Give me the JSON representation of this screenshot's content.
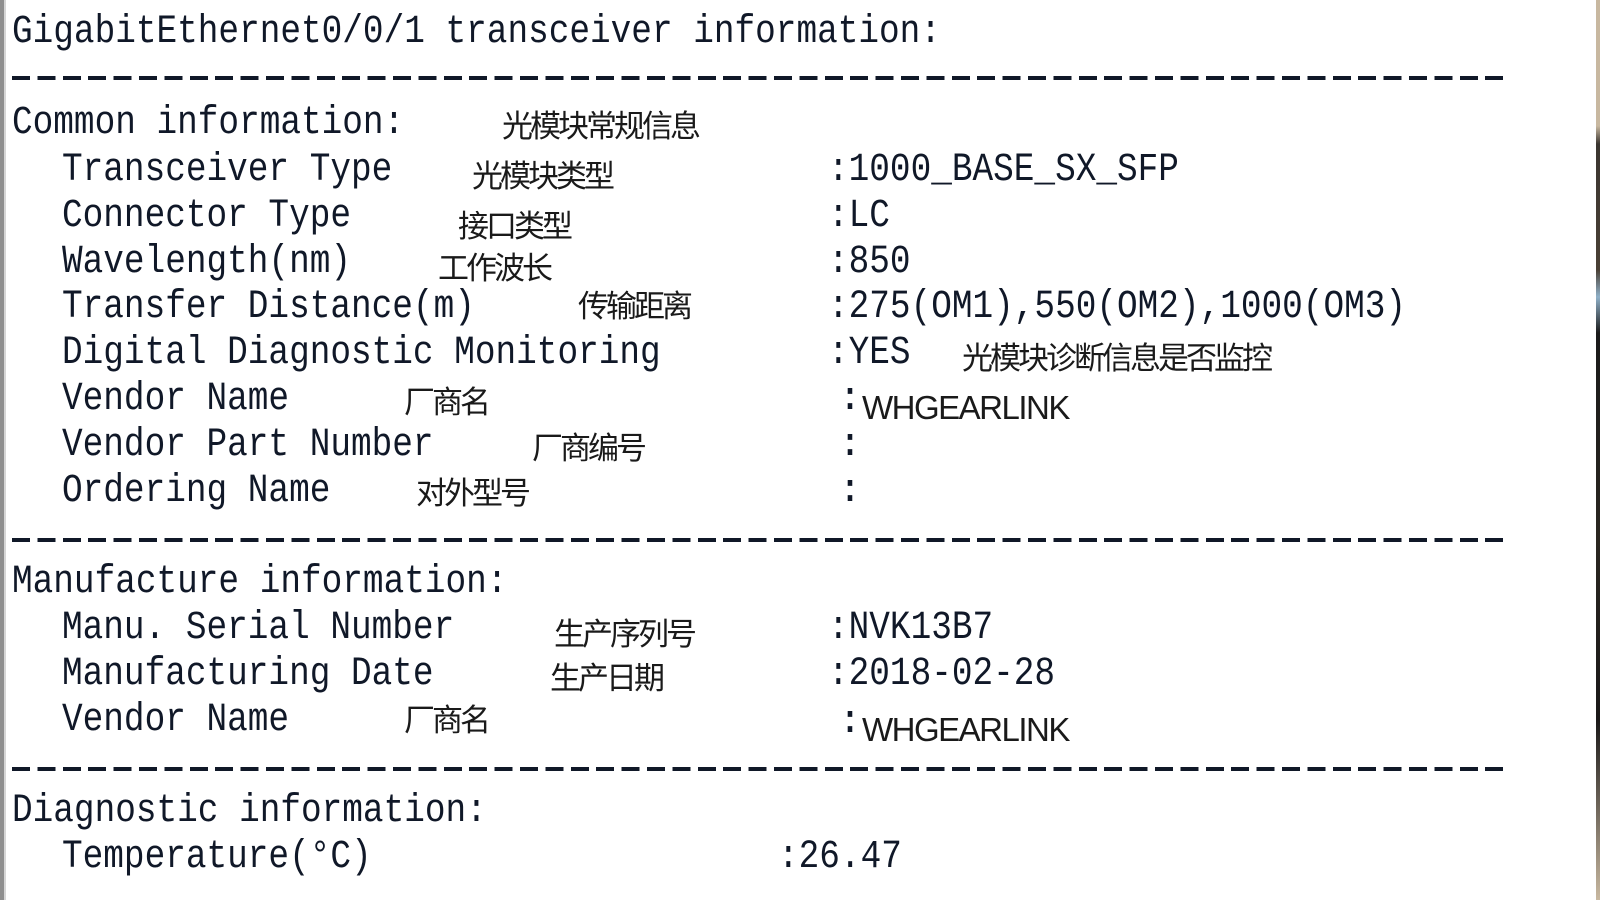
{
  "title": "GigabitEthernet0/0/1 transceiver information:",
  "sections": {
    "common": {
      "heading": "Common information:",
      "heading_cn": "光模块常规信息",
      "rows": [
        {
          "label": "Transceiver Type",
          "cn": "光模块类型",
          "value": ":1000_BASE_SX_SFP"
        },
        {
          "label": "Connector Type",
          "cn": "接口类型",
          "value": ":LC"
        },
        {
          "label": "Wavelength(nm)",
          "cn": "工作波长",
          "value": ":850"
        },
        {
          "label": "Transfer Distance(m)",
          "cn": "传输距离",
          "value": ":275(OM1),550(OM2),1000(OM3)"
        },
        {
          "label": "Digital Diagnostic Monitoring",
          "cn": "",
          "value": ":YES",
          "value_cn": "光模块诊断信息是否监控"
        },
        {
          "label": "Vendor Name",
          "cn": "厂商名",
          "value": "WHGEARLINK"
        },
        {
          "label": "Vendor Part Number",
          "cn": "厂商编号",
          "value": ""
        },
        {
          "label": "Ordering Name",
          "cn": "对外型号",
          "value": ""
        }
      ]
    },
    "manufacture": {
      "heading": "Manufacture information:",
      "rows": [
        {
          "label": "Manu. Serial Number",
          "cn": "生产序列号",
          "value": ":NVK13B7"
        },
        {
          "label": "Manufacturing Date",
          "cn": "生产日期",
          "value": ":2018-02-28"
        },
        {
          "label": "Vendor Name",
          "cn": "厂商名",
          "value": "WHGEARLINK"
        }
      ]
    },
    "diagnostic": {
      "heading": "Diagnostic information:",
      "rows": [
        {
          "label": "Temperature(°C)",
          "value": ":26.47"
        }
      ]
    }
  }
}
